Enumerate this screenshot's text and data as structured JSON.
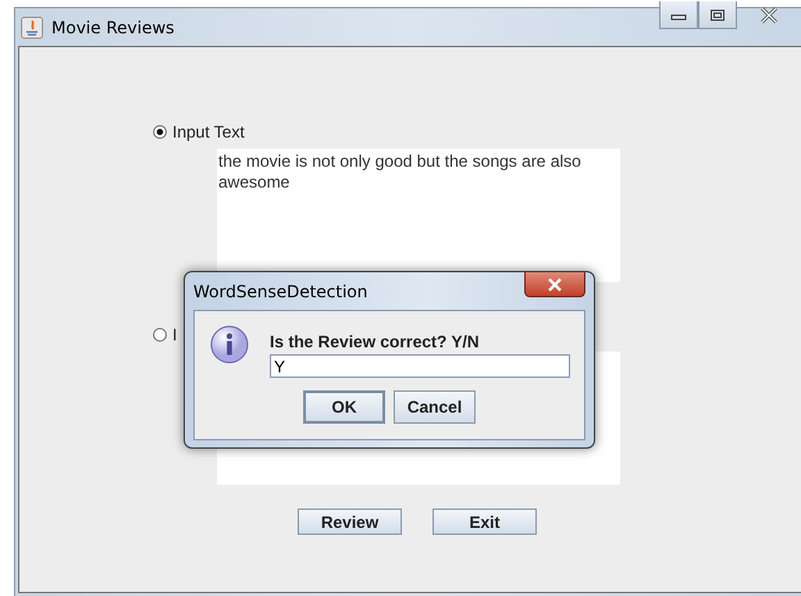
{
  "window": {
    "title": "Movie Reviews"
  },
  "options": [
    {
      "label": "Input Text",
      "selected": true,
      "text": "the movie is not only good but the songs are also awesome"
    },
    {
      "label": "I",
      "selected": false
    }
  ],
  "buttons": [
    "Review",
    "Exit"
  ],
  "dialog": {
    "title": "WordSenseDetection",
    "message": "Is the Review correct? Y/N",
    "input": {
      "value": "Y"
    },
    "buttons": [
      "OK",
      "Cancel"
    ]
  }
}
